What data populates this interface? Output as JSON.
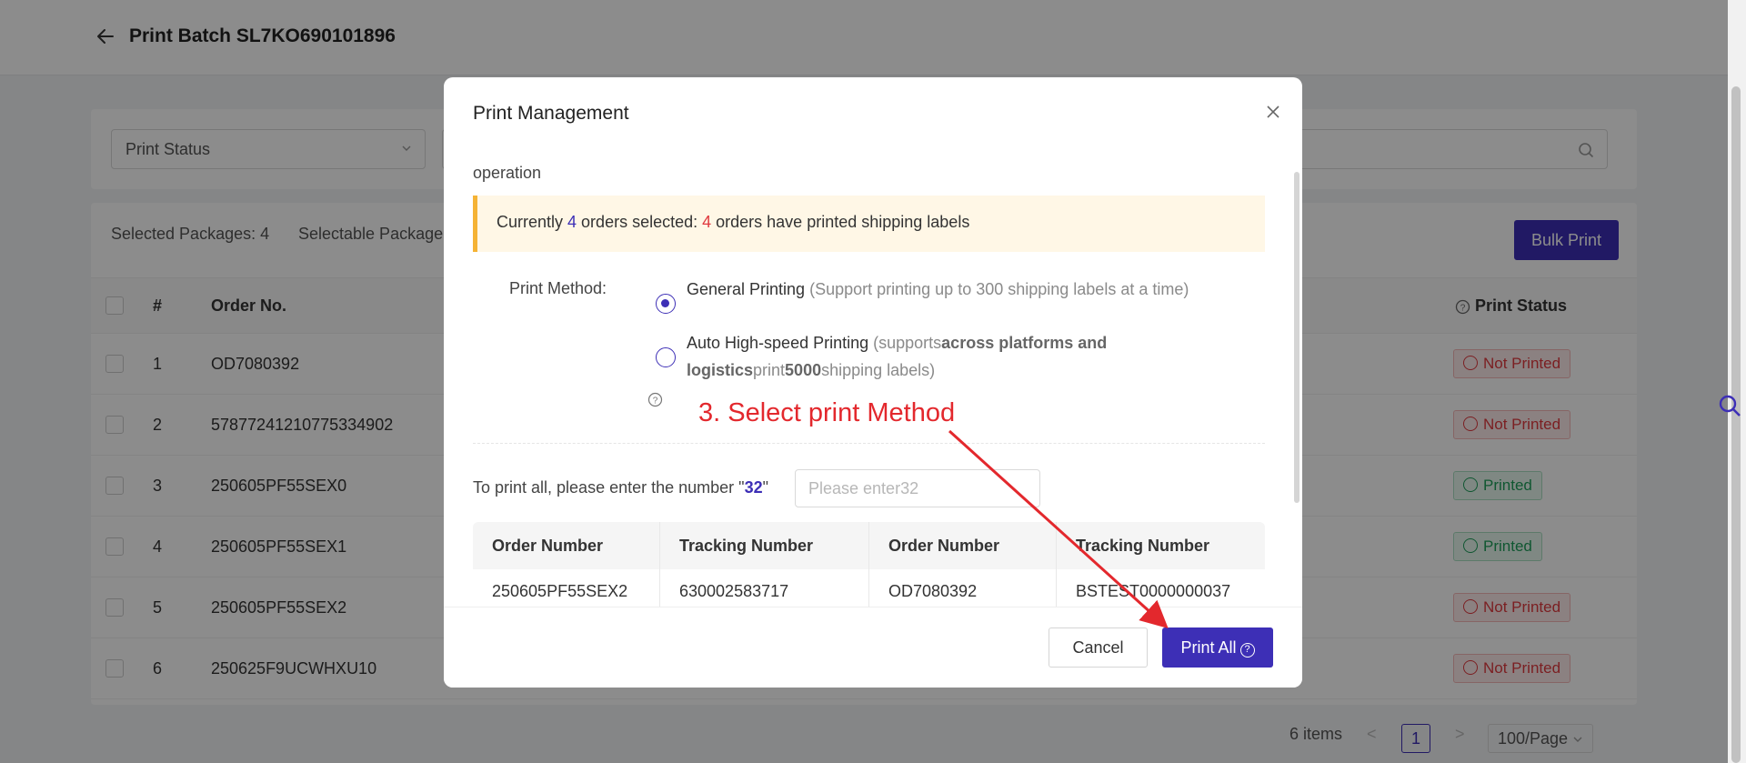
{
  "page": {
    "title": "Print Batch SL7KO690101896",
    "filters": {
      "print_status_placeholder": "Print Status"
    },
    "toolbar": {
      "selected_packages": "Selected Packages: 4",
      "selectable_packages": "Selectable Package",
      "bulk_print_label": "Bulk Print"
    },
    "table": {
      "headers": {
        "index": "#",
        "order_no": "Order No.",
        "print_status": "Print Status"
      },
      "rows": [
        {
          "index": "1",
          "order_no": "OD7080392",
          "status": "Not Printed"
        },
        {
          "index": "2",
          "order_no": "57877241210775334902",
          "status": "Not Printed"
        },
        {
          "index": "3",
          "order_no": "250605PF55SEX0",
          "status": "Printed"
        },
        {
          "index": "4",
          "order_no": "250605PF55SEX1",
          "status": "Printed"
        },
        {
          "index": "5",
          "order_no": "250605PF55SEX2",
          "status": "Not Printed"
        },
        {
          "index": "6",
          "order_no": "250625F9UCWHXU10",
          "status": "Not Printed"
        }
      ]
    },
    "pagination": {
      "total": "6 items",
      "current_page": "1",
      "page_size": "100/Page",
      "prev": "<",
      "next": ">"
    },
    "colors": {
      "accent": "#3d2fb6",
      "danger": "#e0393e",
      "success": "#1e9e5a",
      "warning_border": "#f5b335"
    }
  },
  "modal": {
    "title": "Print Management",
    "operation_label": "operation",
    "alert": {
      "prefix": "Currently ",
      "selected_count": "4",
      "middle": " orders selected: ",
      "printed_count": "4",
      "suffix": " orders have printed shipping labels"
    },
    "print_method_label": "Print Method:",
    "options": [
      {
        "name": "General Printing",
        "note": "(Support printing up to 300 shipping labels at a time)",
        "selected": true
      },
      {
        "name": "Auto High-speed Printing",
        "note_a": " (supports",
        "note_b": "across platforms and logistics",
        "note_c": "print",
        "note_d": "5000",
        "note_e": "shipping labels)",
        "selected": false
      }
    ],
    "annotation": "3. Select print Method",
    "confirm_prefix": "To print all, please enter the number \"",
    "confirm_number": "32",
    "confirm_suffix": "\"",
    "confirm_placeholder": "Please enter32",
    "table_headers": [
      "Order Number",
      "Tracking Number",
      "Order Number",
      "Tracking Number"
    ],
    "table_row": [
      "250605PF55SEX2",
      "630002583717",
      "OD7080392",
      "BSTEST0000000037"
    ],
    "cancel_label": "Cancel",
    "print_all_label": "Print All",
    "help_icon_glyph": "?"
  }
}
